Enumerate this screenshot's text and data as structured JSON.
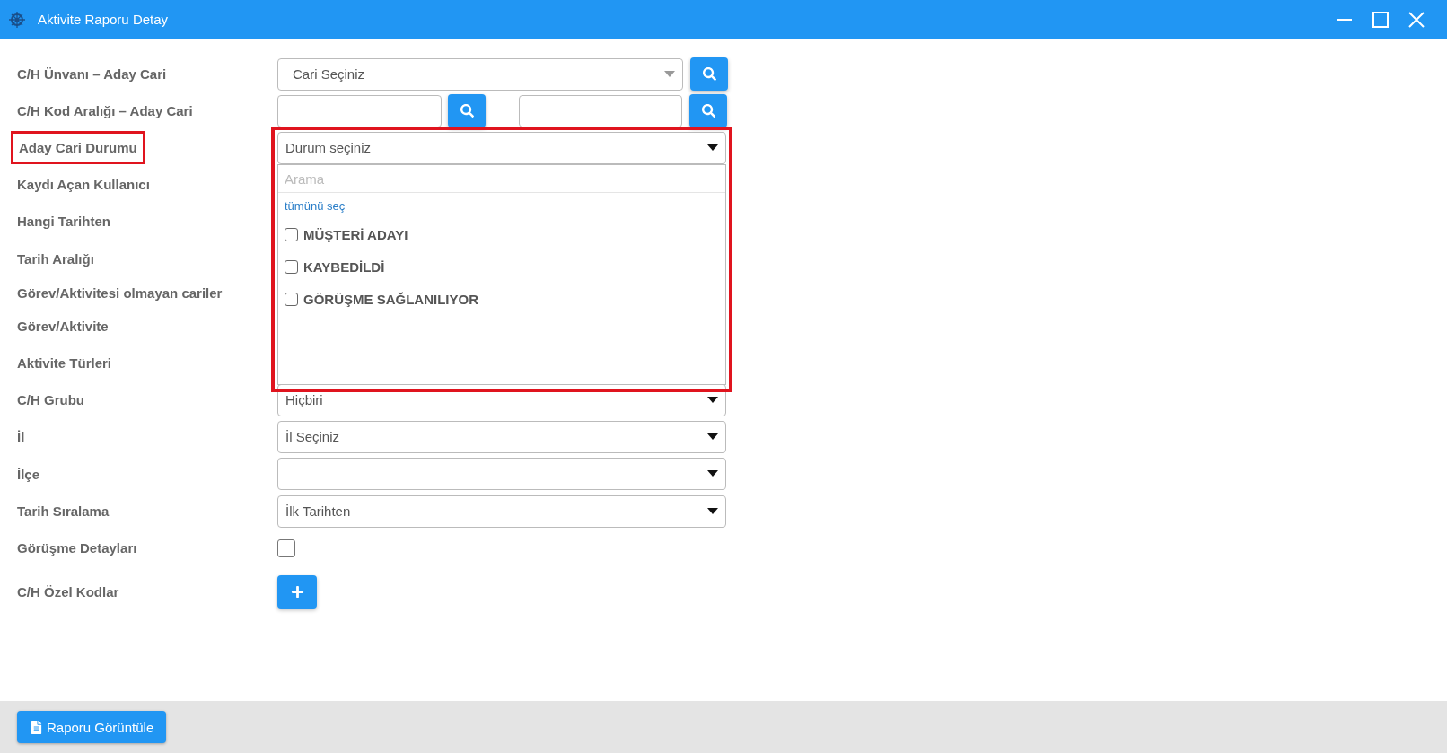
{
  "window": {
    "title": "Aktivite Raporu Detay"
  },
  "form": {
    "rows": [
      {
        "label": "C/H Ünvanı – Aday Cari",
        "highlighted": false,
        "field": {
          "kind": "search-select",
          "value": "Cari Seçiniz"
        }
      },
      {
        "label": "C/H Kod Aralığı – Aday Cari",
        "highlighted": false,
        "field": {
          "kind": "range"
        }
      },
      {
        "label": "Aday Cari Durumu",
        "highlighted": true,
        "field": {
          "kind": "multiselect",
          "placeholder": "Durum seçiniz",
          "expanded": true,
          "highlighted": true,
          "search_placeholder": "Arama",
          "select_all": "tümünü seç",
          "options": [
            {
              "label": "MÜŞTERİ ADAYI",
              "checked": false
            },
            {
              "label": "KAYBEDİLDİ",
              "checked": false
            },
            {
              "label": "GÖRÜŞME SAĞLANILIYOR",
              "checked": false
            }
          ]
        }
      },
      {
        "label": "Kaydı Açan Kullanıcı",
        "highlighted": false
      },
      {
        "label": "Hangi Tarihten",
        "highlighted": false
      },
      {
        "label": "Tarih Aralığı",
        "highlighted": false
      },
      {
        "label": "Görev/Aktivitesi olmayan cariler",
        "highlighted": false
      },
      {
        "label": "Görev/Aktivite",
        "highlighted": false
      },
      {
        "label": "Aktivite Türleri",
        "highlighted": false
      },
      {
        "label": "C/H Grubu",
        "highlighted": false,
        "field": {
          "kind": "select",
          "value": "Hiçbiri"
        }
      },
      {
        "label": "İl",
        "highlighted": false,
        "field": {
          "kind": "select",
          "value": "İl Seçiniz"
        }
      },
      {
        "label": "İlçe",
        "highlighted": false,
        "field": {
          "kind": "select"
        }
      },
      {
        "label": "Tarih Sıralama",
        "highlighted": false,
        "field": {
          "kind": "select",
          "value": "İlk Tarihten"
        }
      },
      {
        "label": "Görüşme Detayları",
        "highlighted": false,
        "field": {
          "kind": "checkbox",
          "checked": false
        }
      },
      {
        "label": "C/H Özel Kodlar",
        "highlighted": false,
        "field": {
          "kind": "add"
        }
      }
    ]
  },
  "footer": {
    "button": "Raporu Görüntüle"
  }
}
